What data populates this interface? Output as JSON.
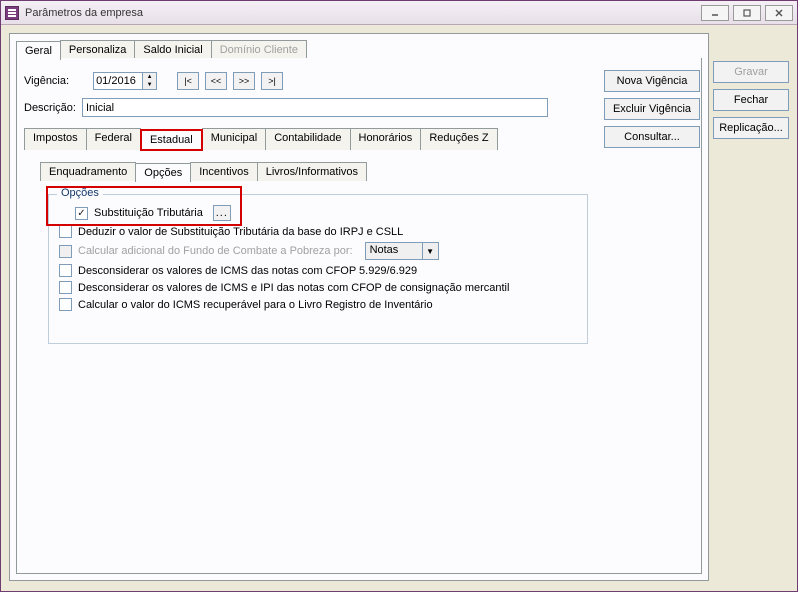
{
  "window": {
    "title": "Parâmetros da empresa"
  },
  "tabs_top": [
    {
      "label": "Geral",
      "active": true
    },
    {
      "label": "Personaliza"
    },
    {
      "label": "Saldo Inicial"
    },
    {
      "label": "Domínio Cliente",
      "disabled": true
    }
  ],
  "vigencia": {
    "label": "Vigência:",
    "value": "01/2016",
    "nav": {
      "first": "|<",
      "prev": "<<",
      "next": ">>",
      "last": ">|"
    }
  },
  "descricao": {
    "label": "Descrição:",
    "value": "Inicial"
  },
  "right_buttons": {
    "nova": "Nova Vigência",
    "excluir": "Excluir Vigência",
    "consultar": "Consultar..."
  },
  "side_buttons": {
    "gravar": "Gravar",
    "fechar": "Fechar",
    "replicacao": "Replicação..."
  },
  "tabs_mid": [
    {
      "label": "Impostos"
    },
    {
      "label": "Federal"
    },
    {
      "label": "Estadual",
      "active": true,
      "highlight": true
    },
    {
      "label": "Municipal"
    },
    {
      "label": "Contabilidade"
    },
    {
      "label": "Honorários"
    },
    {
      "label": "Reduções Z"
    }
  ],
  "tabs_inner": [
    {
      "label": "Enquadramento"
    },
    {
      "label": "Opções",
      "active": true,
      "highlight": true
    },
    {
      "label": "Incentivos"
    },
    {
      "label": "Livros/Informativos"
    }
  ],
  "fieldset": {
    "legend": "Opções",
    "rows": [
      {
        "label": "Substituição Tributária",
        "checked": true,
        "has_button": true,
        "button": "..."
      },
      {
        "label": "Deduzir o valor de Substituição Tributária da base do IRPJ e CSLL"
      },
      {
        "label": "Calcular adicional do Fundo de Combate a Pobreza por:",
        "disabled": true,
        "has_select": true,
        "select_value": "Notas"
      },
      {
        "label": "Desconsiderar os valores de ICMS das notas com CFOP 5.929/6.929"
      },
      {
        "label": "Desconsiderar os valores de ICMS e IPI das notas com CFOP de consignação mercantil"
      },
      {
        "label": "Calcular o valor do ICMS recuperável para o Livro Registro de Inventário"
      }
    ]
  }
}
